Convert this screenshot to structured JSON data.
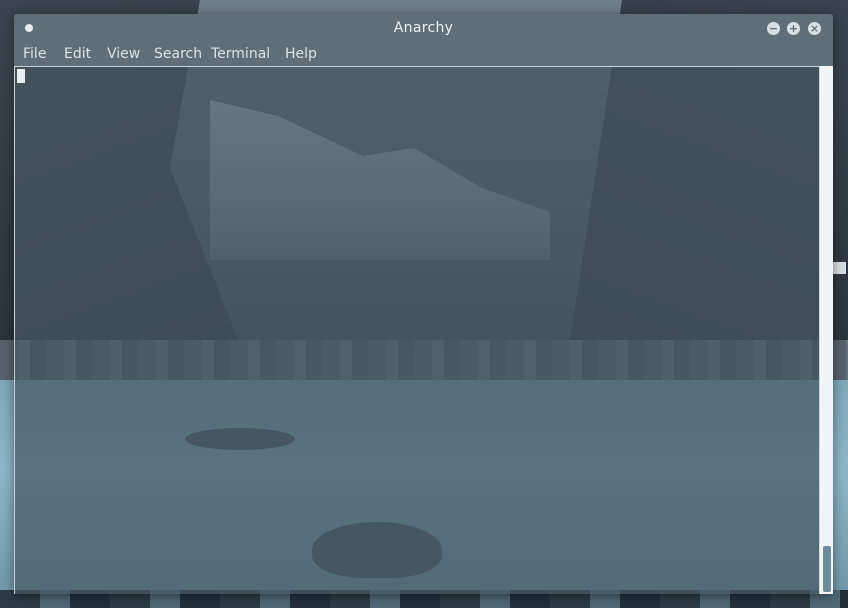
{
  "window": {
    "title": "Anarchy",
    "controls": {
      "minimize_icon": "−",
      "maximize_icon": "+",
      "close_icon": "×"
    }
  },
  "menubar": {
    "items": [
      {
        "label": "File"
      },
      {
        "label": "Edit"
      },
      {
        "label": "View"
      },
      {
        "label": "Search"
      },
      {
        "label": "Terminal"
      },
      {
        "label": "Help"
      }
    ]
  },
  "terminal": {
    "content": "",
    "cursor_icon": "block-cursor",
    "scroll_position": 1.0
  },
  "colors": {
    "titlebar": "#5e6f78",
    "terminal_bg": "#465964",
    "menu_text": "#dde3e6",
    "scroll_thumb": "#6e8b9b"
  }
}
